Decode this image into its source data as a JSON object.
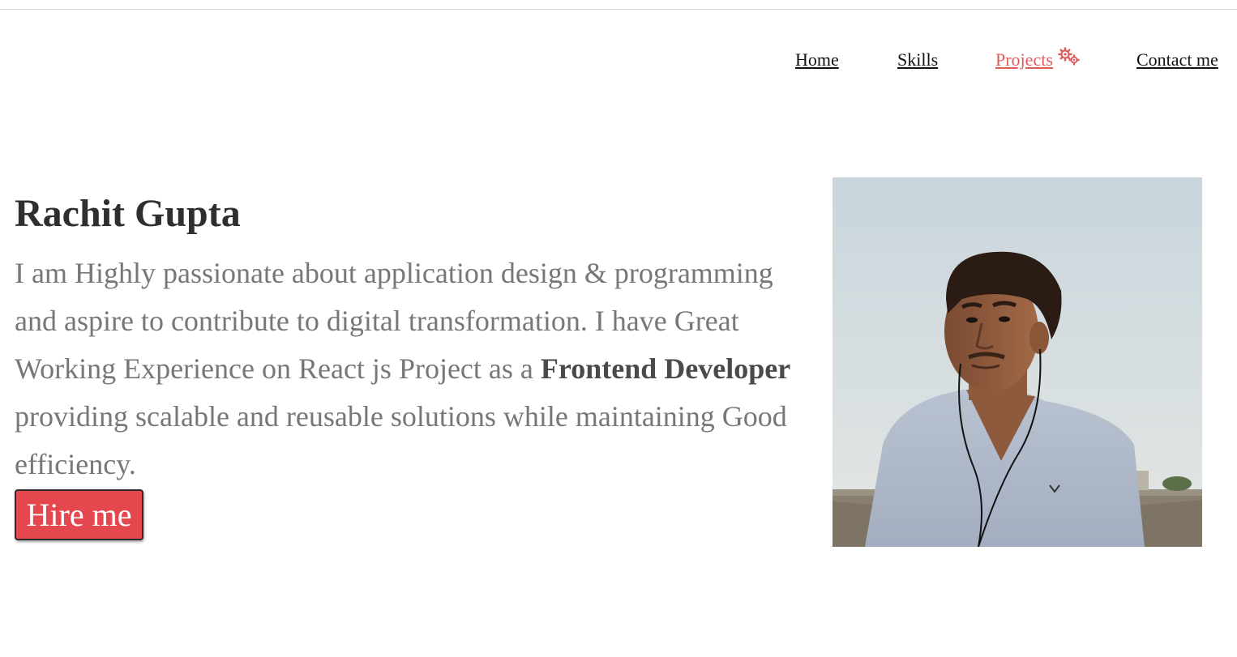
{
  "nav": {
    "items": [
      {
        "label": "Home"
      },
      {
        "label": "Skills"
      },
      {
        "label": "Projects",
        "active": true,
        "icon": "gears-icon"
      },
      {
        "label": "Contact me"
      }
    ],
    "active_color": "#e05a5a"
  },
  "hero": {
    "name": "Rachit Gupta",
    "line1": "I am Highly passionate about application design & programming and aspire to contribute to digital transformation. I have Great Working Experience on React js Project as a",
    "role": "Frontend Developer",
    "line2": " providing scalable and reusable solutions while maintaining Good efficiency.",
    "cta_label": "Hire me",
    "cta_color": "#e5474f"
  },
  "photo": {
    "icon": "profile-photo"
  }
}
